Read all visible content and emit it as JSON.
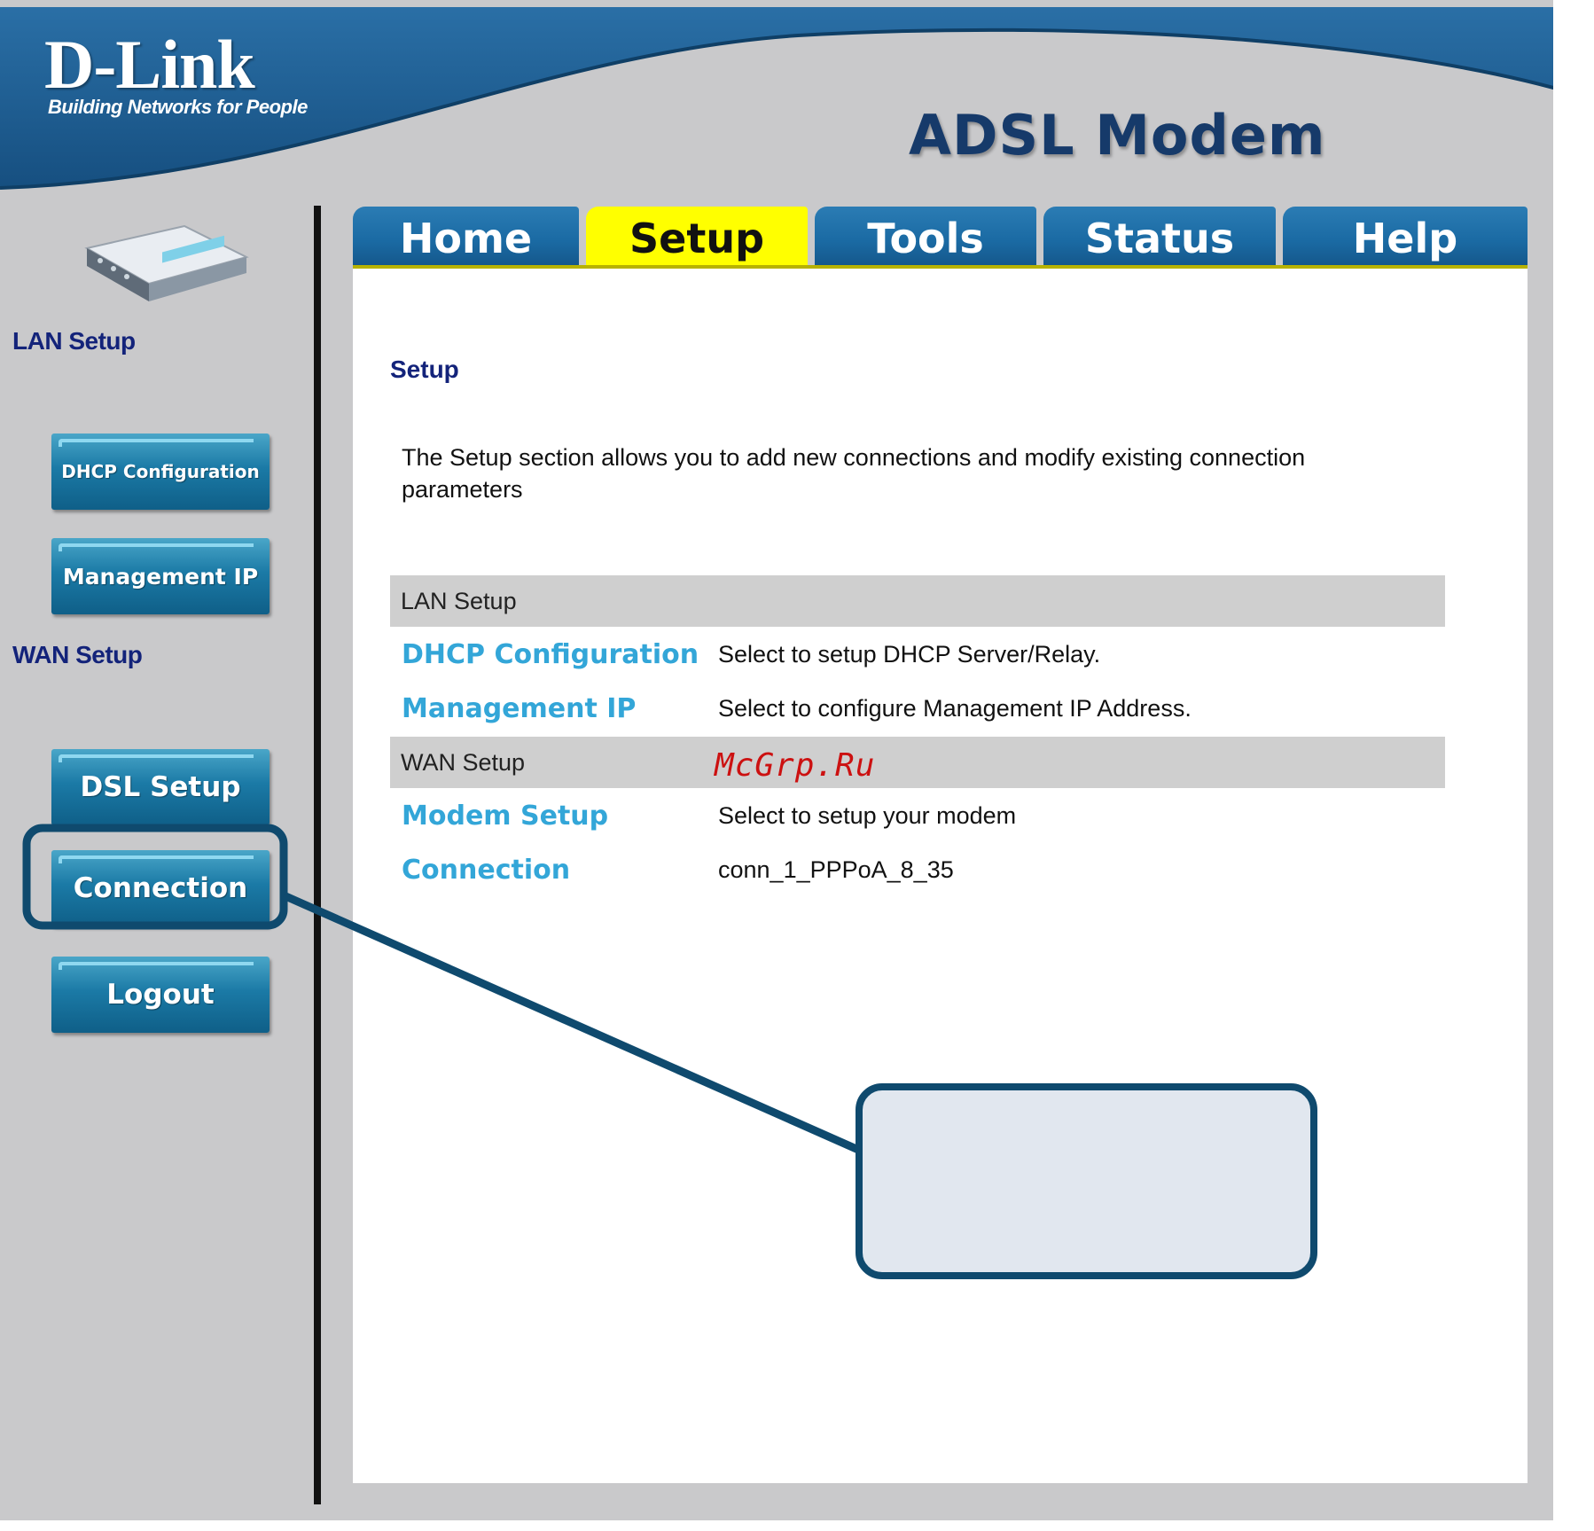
{
  "header": {
    "logo": "D-Link",
    "tagline": "Building Networks for People",
    "product": "ADSL Modem"
  },
  "tabs": [
    {
      "label": "Home",
      "active": false
    },
    {
      "label": "Setup",
      "active": true
    },
    {
      "label": "Tools",
      "active": false
    },
    {
      "label": "Status",
      "active": false
    },
    {
      "label": "Help",
      "active": false
    }
  ],
  "sidebar": {
    "lan_heading": "LAN Setup",
    "wan_heading": "WAN Setup",
    "buttons": [
      {
        "label": "DHCP Configuration"
      },
      {
        "label": "Management IP"
      },
      {
        "label": "DSL Setup"
      },
      {
        "label": "Connection"
      },
      {
        "label": "Logout"
      }
    ]
  },
  "content": {
    "title": "Setup",
    "description": "The Setup section allows you to add new connections and modify existing connection parameters",
    "lan_group": "LAN Setup",
    "wan_group": "WAN Setup",
    "rows": [
      {
        "link": "DHCP Configuration",
        "desc": "Select to setup DHCP Server/Relay."
      },
      {
        "link": "Management IP",
        "desc": "Select to configure Management IP Address."
      },
      {
        "link": "Modem Setup",
        "desc": "Select to setup your modem"
      },
      {
        "link": "Connection",
        "desc": "conn_1_PPPoA_8_35"
      }
    ]
  },
  "watermark": "McGrp.Ru",
  "colors": {
    "header_blue": "#1b5f93",
    "tab_blue": "#1a6aa3",
    "active_tab": "#ffff00",
    "link": "#33a6d8",
    "heading_navy": "#13237a",
    "callout_border": "#0f4a6e",
    "callout_fill": "#e1e7ef"
  }
}
